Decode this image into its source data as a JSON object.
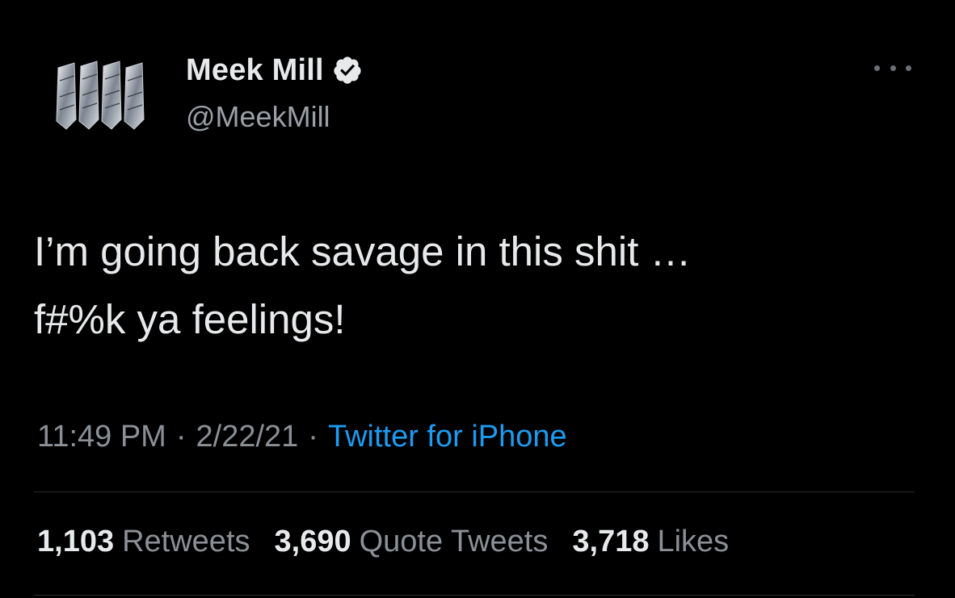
{
  "author": {
    "display_name": "Meek Mill",
    "handle": "@MeekMill",
    "verified_icon": "verified-badge-icon",
    "avatar_icon": "diamond-crystals-avatar"
  },
  "tweet": {
    "text": "I’m going back savage in this shit …\nf#%k ya feelings!",
    "time": "11:49 PM",
    "separator": "·",
    "date": "2/22/21",
    "source": "Twitter for iPhone"
  },
  "stats": {
    "retweets_count": "1,103",
    "retweets_label": "Retweets",
    "quotes_count": "3,690",
    "quotes_label": "Quote Tweets",
    "likes_count": "3,718",
    "likes_label": "Likes"
  },
  "colors": {
    "background": "#000000",
    "link": "#1d9bf0",
    "muted": "#8b9096"
  }
}
